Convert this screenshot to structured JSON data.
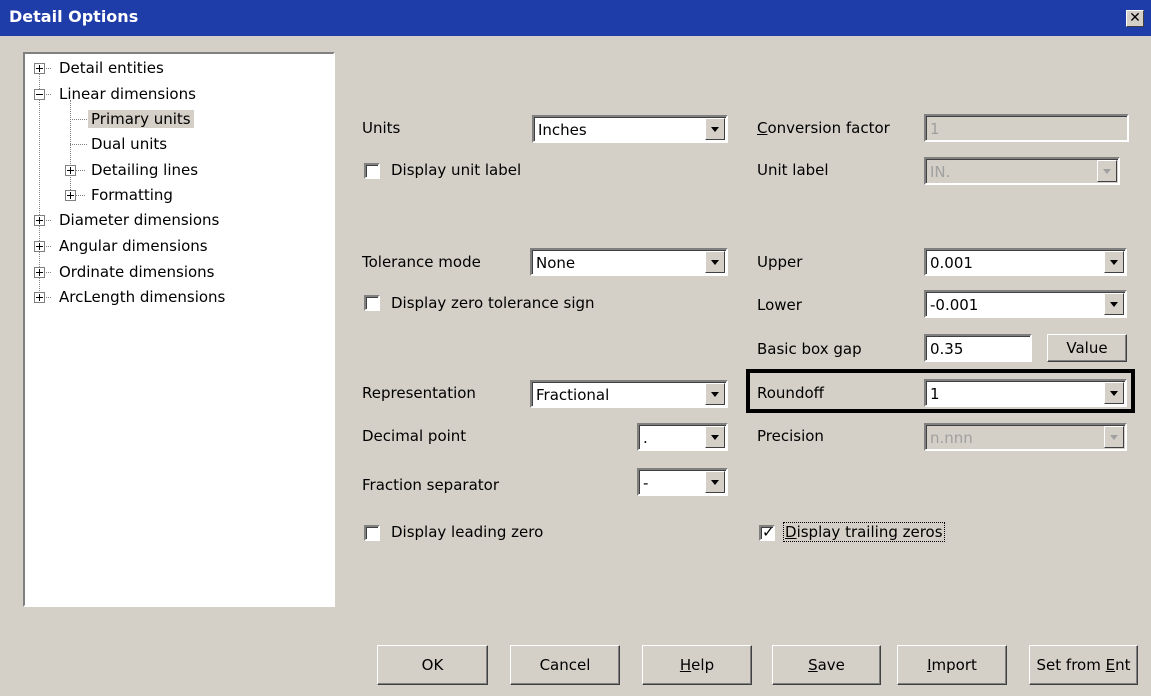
{
  "window": {
    "title": "Detail Options",
    "close_icon": "close-icon"
  },
  "tree": {
    "items": [
      {
        "label": "Detail entities"
      },
      {
        "label": "Linear dimensions"
      },
      {
        "label": "Primary units"
      },
      {
        "label": "Dual units"
      },
      {
        "label": "Detailing lines"
      },
      {
        "label": "Formatting"
      },
      {
        "label": "Diameter dimensions"
      },
      {
        "label": "Angular dimensions"
      },
      {
        "label": "Ordinate dimensions"
      },
      {
        "label": "ArcLength dimensions"
      }
    ],
    "selected": "Primary units"
  },
  "units": {
    "label": "Units",
    "value": "Inches"
  },
  "display_unit_label": {
    "label": "Display unit label",
    "checked": false
  },
  "conversion_factor": {
    "label_u": "C",
    "label_rest": "onversion factor",
    "value": "1"
  },
  "unit_label": {
    "label": "Unit label",
    "value": "IN."
  },
  "tolerance_mode": {
    "label": "Tolerance mode",
    "value": "None"
  },
  "display_zero_tolerance": {
    "label": "Display zero tolerance sign",
    "checked": false
  },
  "upper": {
    "label": "Upper",
    "value": "0.001"
  },
  "lower": {
    "label": "Lower",
    "value": "-0.001"
  },
  "basic_box_gap": {
    "label": "Basic box gap",
    "value": "0.35",
    "button": "Value"
  },
  "representation": {
    "label": "Representation",
    "value": "Fractional"
  },
  "roundoff": {
    "label": "Roundoff",
    "value": "1"
  },
  "decimal_point": {
    "label": "Decimal point",
    "value": "."
  },
  "precision": {
    "label": "Precision",
    "value": "n.nnn"
  },
  "fraction_separator": {
    "label": "Fraction separator",
    "value": "-"
  },
  "display_leading_zero": {
    "label": "Display leading zero",
    "checked": false
  },
  "display_trailing_zeros": {
    "label_u": "D",
    "label_rest": "isplay trailing zeros",
    "checked": true
  },
  "buttons": {
    "ok": "OK",
    "cancel": "Cancel",
    "help_u": "H",
    "help_rest": "elp",
    "save_u": "S",
    "save_rest": "ave",
    "import_u": "I",
    "import_rest": "mport",
    "setfrom_pre": "Set from ",
    "setfrom_u": "E",
    "setfrom_rest": "nt"
  }
}
